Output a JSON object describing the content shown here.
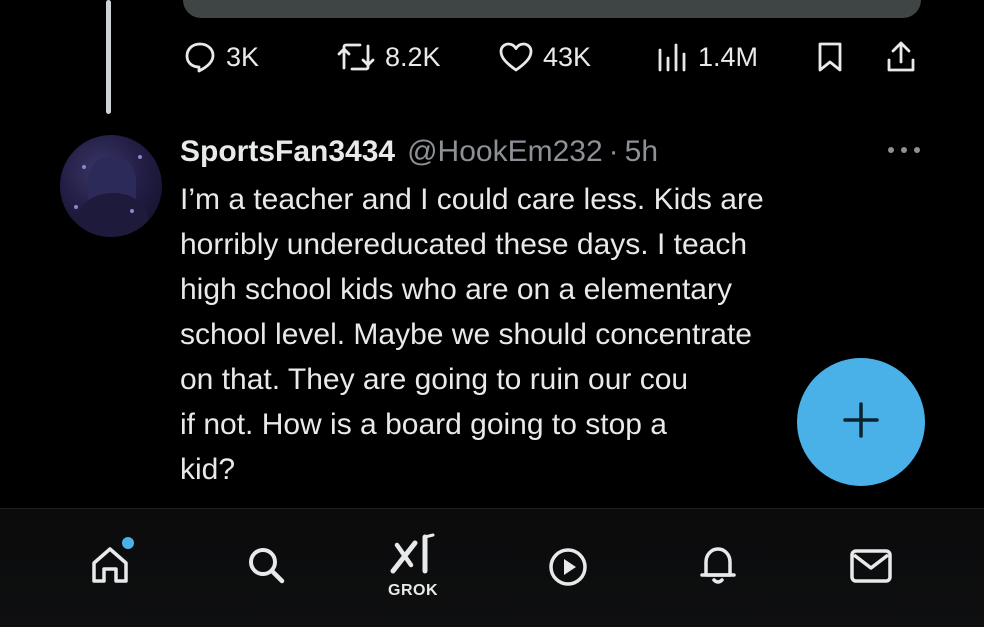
{
  "actions": {
    "replies": "3K",
    "reposts": "8.2K",
    "likes": "43K",
    "views": "1.4M"
  },
  "tweet": {
    "display_name": "SportsFan3434",
    "handle": "@HookEm232",
    "separator": "·",
    "time": "5h",
    "lines": [
      "I’m a teacher and I could care less. Kids are",
      "horribly undereducated these days. I teach",
      "high school kids who are on a elementary",
      "school level. Maybe we should concentrate",
      "on that. They are going to ruin our cou",
      "if not. How is a board going to stop a",
      "kid?"
    ]
  },
  "nav": {
    "grok_label": "GROK"
  },
  "colors": {
    "accent": "#4ab1e8",
    "text": "#e7e9ea",
    "muted": "#8b9196",
    "background": "#000000"
  },
  "icons": [
    "reply-icon",
    "repost-icon",
    "like-icon",
    "views-icon",
    "bookmark-icon",
    "share-icon",
    "more-icon",
    "compose-plus-icon",
    "home-icon",
    "search-icon",
    "grok-icon",
    "play-icon",
    "bell-icon",
    "mail-icon"
  ]
}
